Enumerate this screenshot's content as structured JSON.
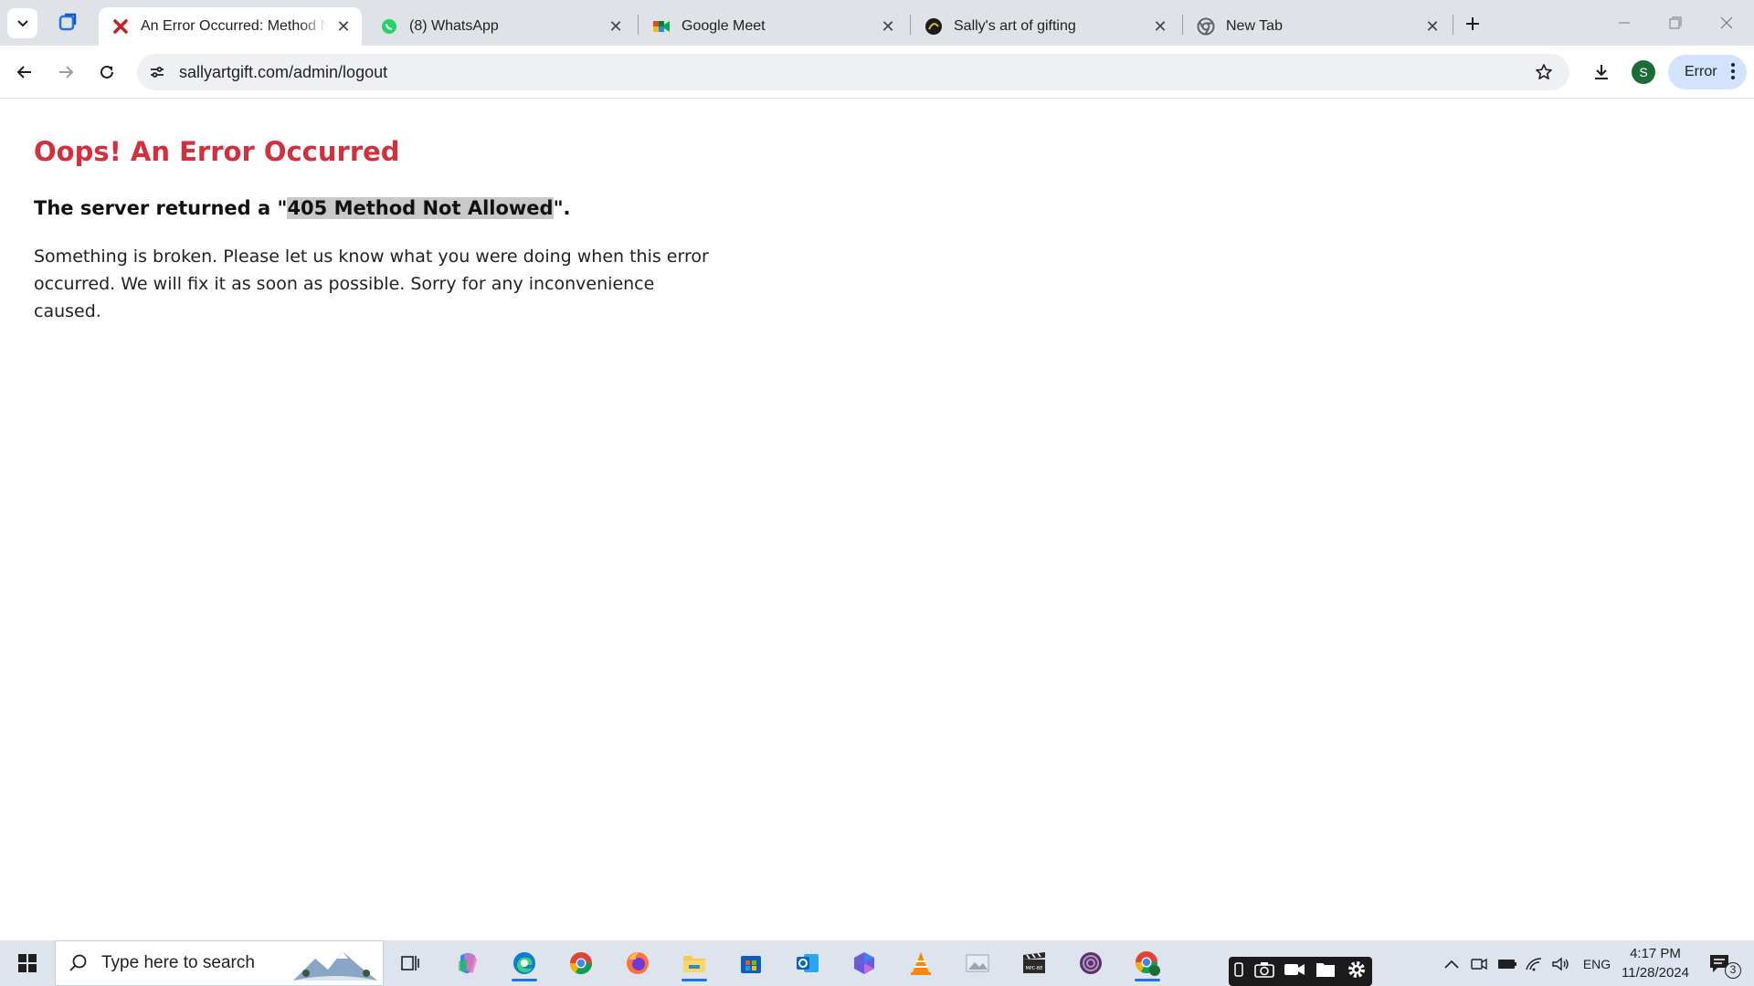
{
  "browser": {
    "tabs": [
      {
        "label": "An Error Occurred: Method Not Allowed",
        "favicon": "red-x-icon",
        "active": true
      },
      {
        "label": "(8) WhatsApp",
        "favicon": "whatsapp-icon",
        "active": false
      },
      {
        "label": "Google Meet",
        "favicon": "google-meet-icon",
        "active": false
      },
      {
        "label": "Sally's art of gifting",
        "favicon": "sally-logo-icon",
        "active": false
      },
      {
        "label": "New Tab",
        "favicon": "chrome-icon",
        "active": false
      }
    ],
    "url": "sallyartgift.com/admin/logout",
    "profile_initial": "S",
    "error_chip_label": "Error"
  },
  "page": {
    "heading": "Oops! An Error Occurred",
    "subheading_prefix": "The server returned a \"",
    "subheading_highlight": "405 Method Not Allowed",
    "subheading_suffix": "\".",
    "body": "Something is broken. Please let us know what you were doing when this error occurred. We will fix it as soon as possible. Sorry for any inconvenience caused."
  },
  "taskbar": {
    "search_placeholder": "Type here to search",
    "apps": [
      "task-view-icon",
      "copilot-icon",
      "edge-icon",
      "chrome-icon",
      "firefox-icon",
      "file-explorer-icon",
      "microsoft-store-icon",
      "outlook-icon",
      "m365-icon",
      "vlc-icon",
      "photos-icon",
      "video-editor-icon",
      "tor-browser-icon",
      "chrome-profile-icon"
    ],
    "language": "ENG",
    "time": "4:17 PM",
    "date": "11/28/2024",
    "notification_count": "3"
  },
  "colors": {
    "heading_red": "#d32f3c",
    "tabstrip_bg": "#dfe3e8",
    "taskbar_bg": "#dde4ee",
    "highlight_bg": "#c9c9c9"
  }
}
